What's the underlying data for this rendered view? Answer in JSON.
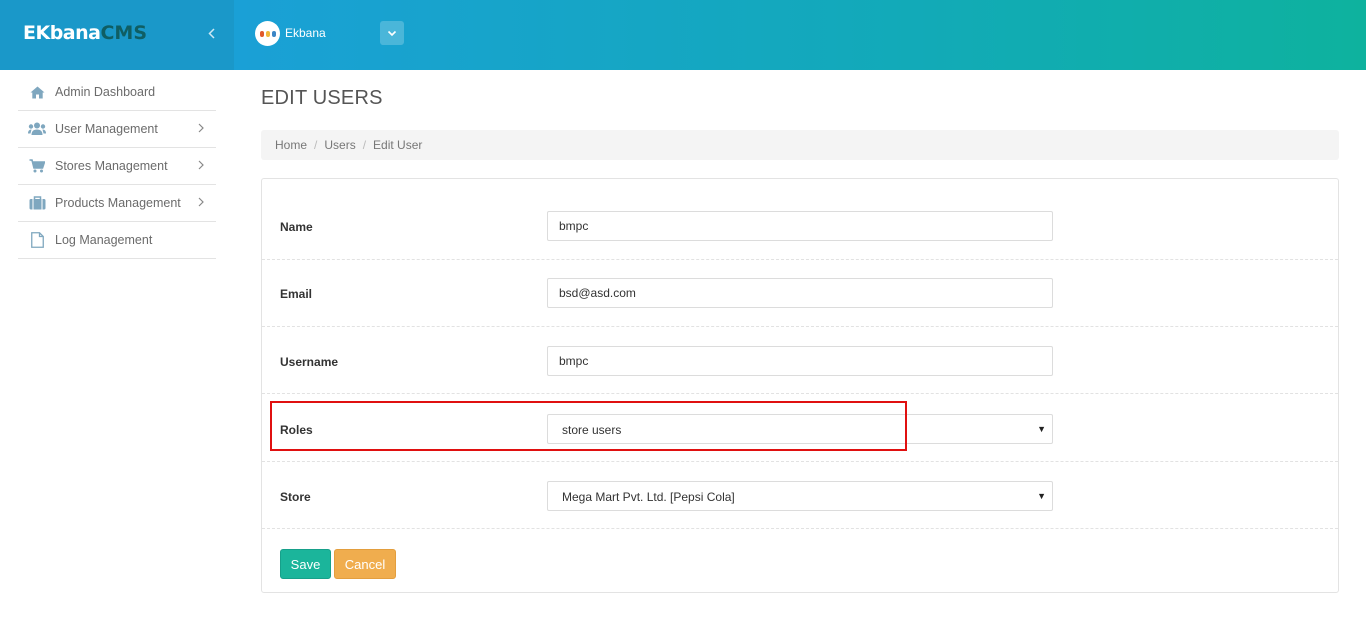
{
  "brand": {
    "name": "EKbana",
    "suffix": "CMS",
    "collapse_icon": "chevron-left-icon"
  },
  "org": {
    "name": "Ekbana",
    "dropdown_icon": "chevron-down-icon"
  },
  "sidebar": {
    "items": [
      {
        "label": "Admin Dashboard",
        "icon": "home-icon",
        "has_submenu": false
      },
      {
        "label": "User Management",
        "icon": "users-icon",
        "has_submenu": true
      },
      {
        "label": "Stores Management",
        "icon": "cart-icon",
        "has_submenu": true
      },
      {
        "label": "Products Management",
        "icon": "briefcase-icon",
        "has_submenu": true
      },
      {
        "label": "Log Management",
        "icon": "file-icon",
        "has_submenu": false
      }
    ]
  },
  "page": {
    "title": "EDIT USERS"
  },
  "breadcrumb": {
    "items": [
      "Home",
      "Users",
      "Edit User"
    ],
    "separator": "/"
  },
  "form": {
    "name": {
      "label": "Name",
      "value": "bmpc"
    },
    "email": {
      "label": "Email",
      "value": "bsd@asd.com"
    },
    "username": {
      "label": "Username",
      "value": "bmpc"
    },
    "roles": {
      "label": "Roles",
      "selected": "store users"
    },
    "store": {
      "label": "Store",
      "selected": "Mega Mart Pvt. Ltd. [Pepsi Cola]"
    }
  },
  "actions": {
    "save_label": "Save",
    "cancel_label": "Cancel"
  },
  "colors": {
    "brand_bg": "#1a98c9",
    "header_gradient_start": "#1aa0d6",
    "header_gradient_end": "#0eb29e",
    "save_button": "#1bb59b",
    "cancel_button": "#f0ad4e",
    "highlight_border": "#e01010"
  }
}
